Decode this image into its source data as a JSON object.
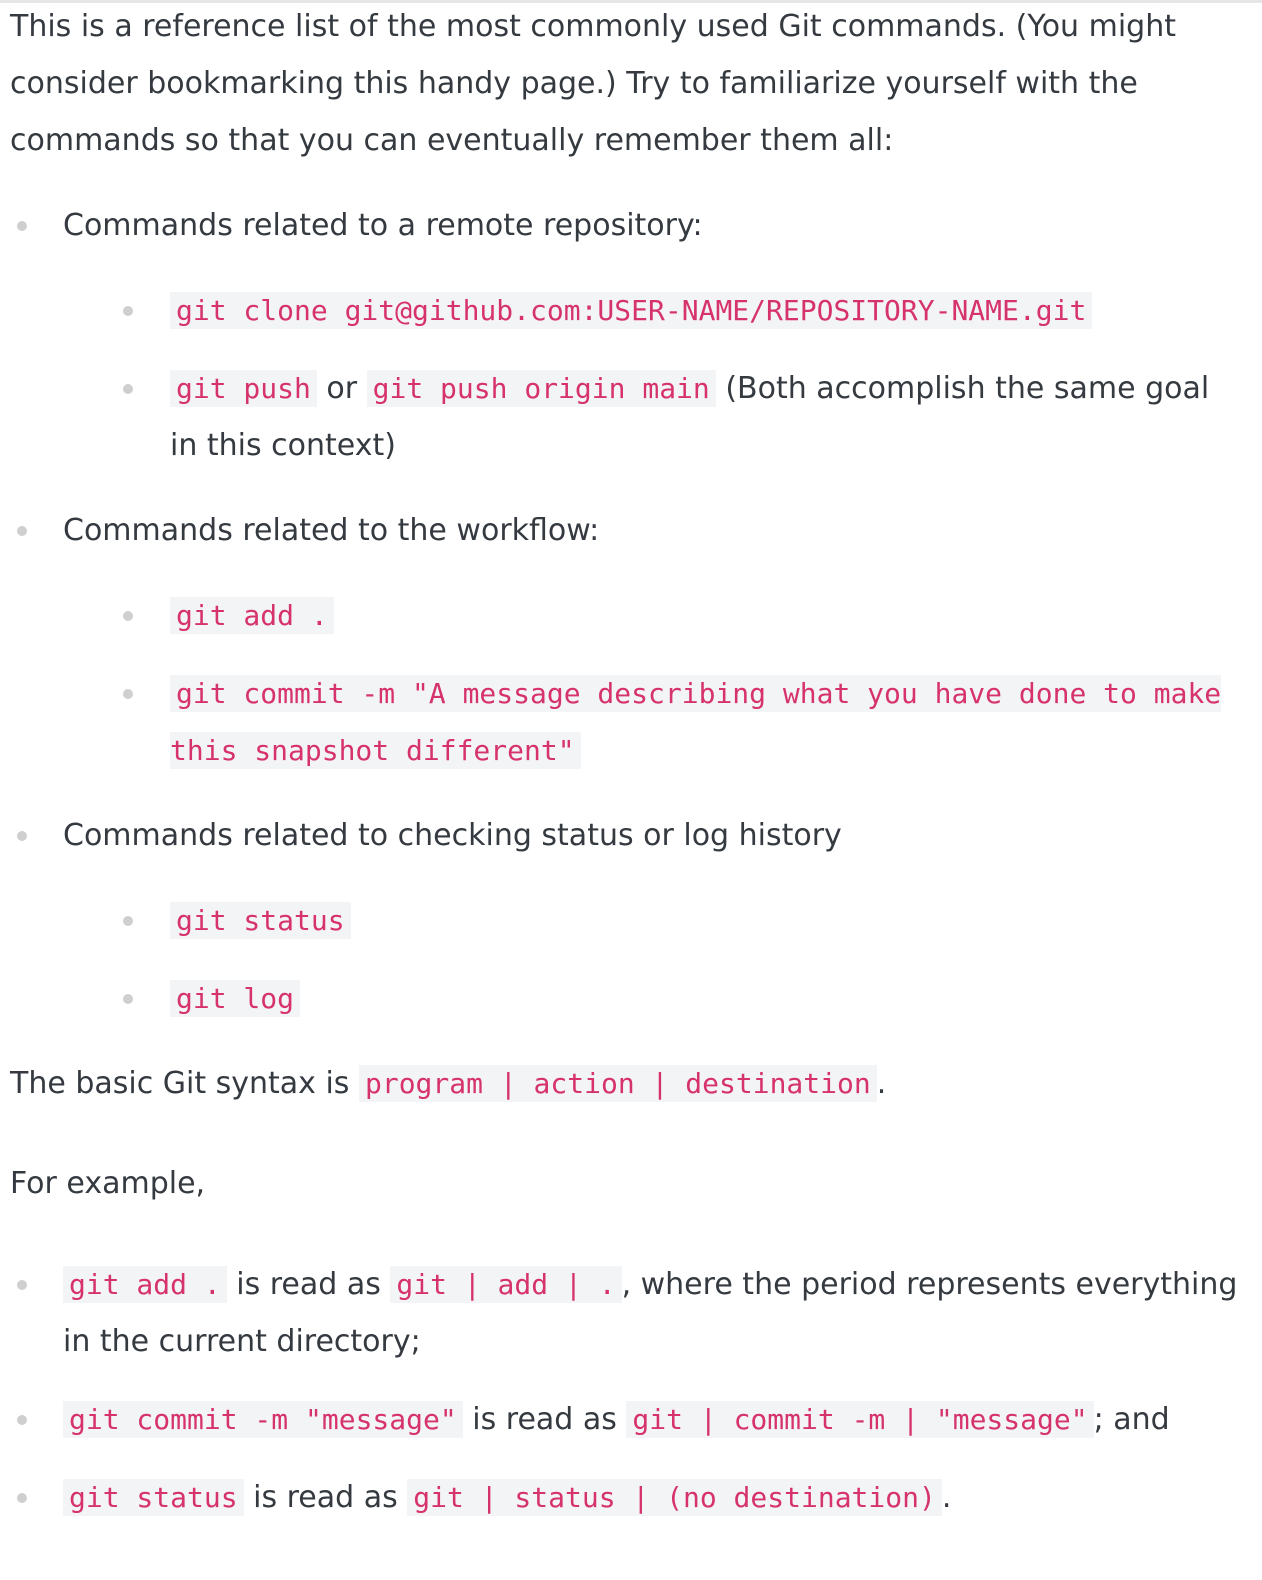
{
  "intro": "This is a reference list of the most commonly used Git commands. (You might consider bookmarking this handy page.) Try to familiarize yourself with the commands so that you can eventually remember them all:",
  "sections": [
    {
      "heading": "Commands related to a remote repository:",
      "items": [
        {
          "code1": "git clone git@github.com:USER-NAME/REPOSITORY-NAME.git"
        },
        {
          "code1": "git push",
          "mid": " or ",
          "code2": "git push origin main",
          "after": " (Both accomplish the same goal in this context)"
        }
      ]
    },
    {
      "heading": "Commands related to the workflow:",
      "items": [
        {
          "code1": "git add ."
        },
        {
          "code1": "git commit -m \"A message describing what you have done to make this snapshot different\""
        }
      ]
    },
    {
      "heading": "Commands related to checking status or log history",
      "items": [
        {
          "code1": "git status"
        },
        {
          "code1": "git log"
        }
      ]
    }
  ],
  "syntax": {
    "before": "The basic Git syntax is ",
    "code": "program | action | destination",
    "after": "."
  },
  "example_intro": "For example,",
  "examples": [
    {
      "code": "git add .",
      "mid": " is read as ",
      "read": "git | add | .",
      "after": ", where the period represents everything in the current directory;"
    },
    {
      "code": "git commit -m \"message\"",
      "mid": " is read as ",
      "read": "git | commit -m | \"message\"",
      "after": "; and"
    },
    {
      "code": "git status",
      "mid": " is read as ",
      "read": "git | status | (no destination)",
      "after": "."
    }
  ]
}
